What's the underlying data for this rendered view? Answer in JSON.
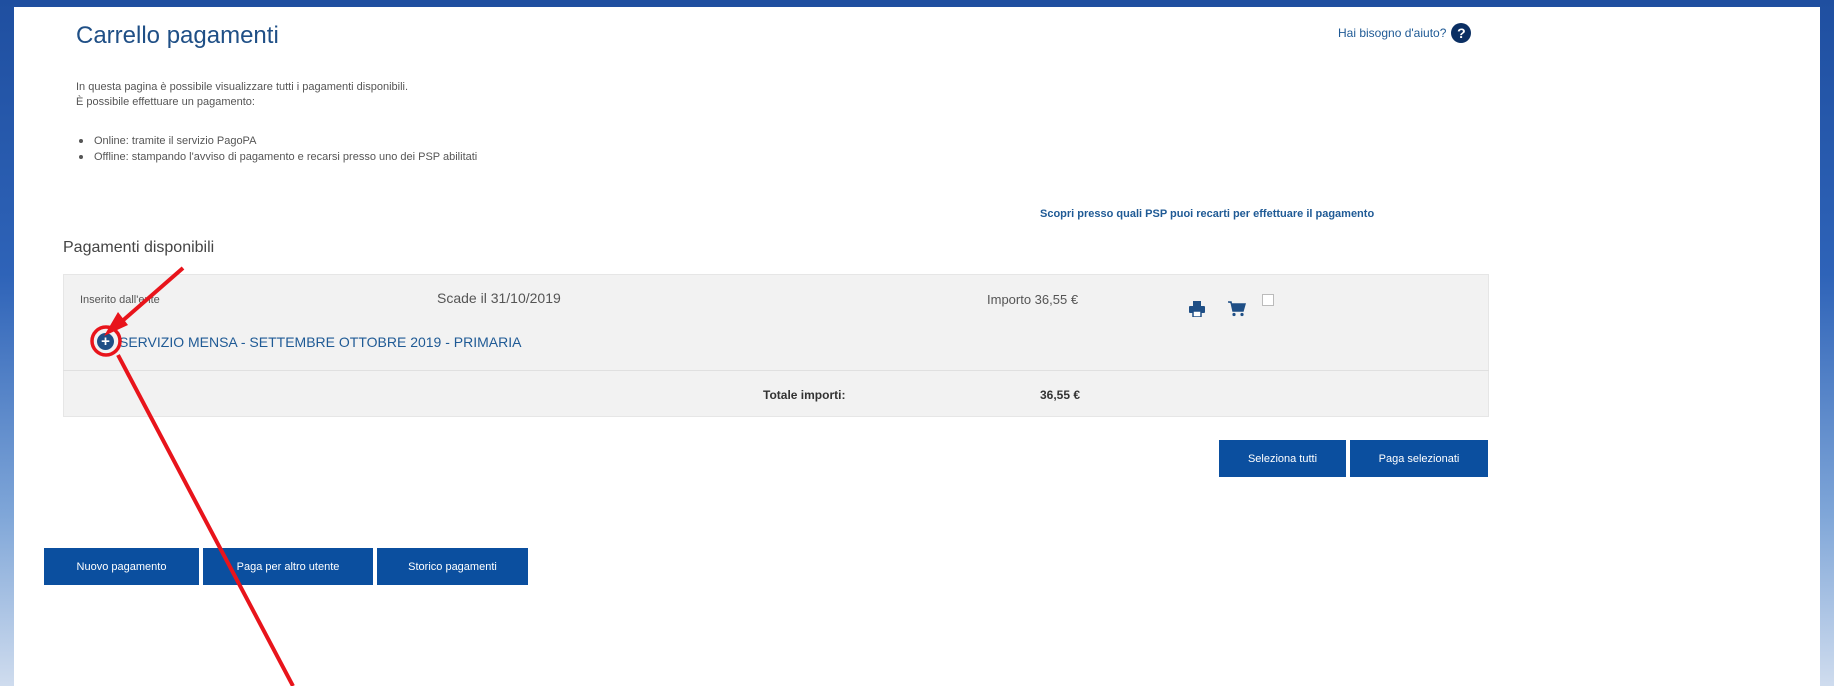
{
  "page": {
    "title": "Carrello pagamenti",
    "help_text": "Hai bisogno d'aiuto?",
    "help_icon": "question-circle-icon"
  },
  "intro": {
    "line1": "In questa pagina è possibile visualizzare tutti i pagamenti disponibili.",
    "line2": "È possibile effettuare un pagamento:",
    "bullets": [
      "Online: tramite il servizio PagoPA",
      "Offline: stampando l'avviso di pagamento e recarsi presso uno dei PSP abilitati"
    ]
  },
  "psp_link": "Scopri presso quali PSP puoi recarti per effettuare il pagamento",
  "section_title": "Pagamenti disponibili",
  "payment": {
    "inserito": "Inserito dall'ente",
    "scade": "Scade il 31/10/2019",
    "importo": "Importo 36,55 €",
    "description": "SERVIZIO MENSA - SETTEMBRE OTTOBRE 2019 - PRIMARIA",
    "icons": [
      "plus-circle-icon",
      "print-icon",
      "cart-icon"
    ]
  },
  "totals": {
    "label": "Totale importi:",
    "value": "36,55 €"
  },
  "buttons": {
    "seleziona_tutti": "Seleziona tutti",
    "paga_selezionati": "Paga selezionati",
    "nuovo_pagamento": "Nuovo pagamento",
    "paga_altro_utente": "Paga per altro utente",
    "storico_pagamenti": "Storico pagamenti"
  },
  "colors": {
    "brand": "#1f4f86",
    "button": "#0b4f9f",
    "annotation": "#e8141b",
    "frame": "#1f4fa0"
  }
}
